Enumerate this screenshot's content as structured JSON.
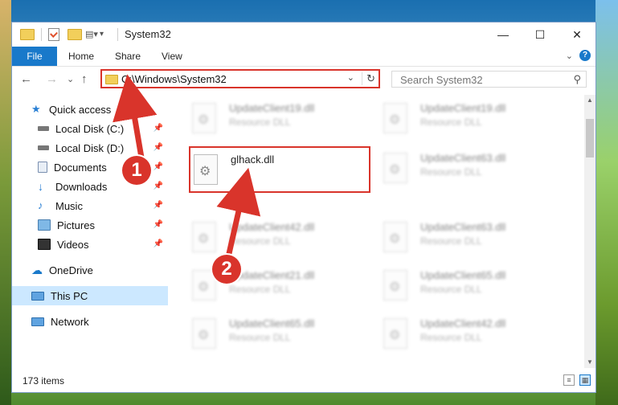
{
  "window": {
    "title": "System32"
  },
  "ribbon": {
    "tabs": [
      "File",
      "Home",
      "Share",
      "View"
    ]
  },
  "titlebar": {
    "minimize": "—",
    "maximize": "☐",
    "close": "✕"
  },
  "nav": {
    "back": "←",
    "forward": "→",
    "recent": "⌄",
    "up": "↑",
    "address": "C:\\Windows\\System32",
    "search_placeholder": "Search System32"
  },
  "sidebar": {
    "items": [
      {
        "label": "Quick access",
        "icon": "star-icon"
      },
      {
        "label": "Local Disk (C:)",
        "icon": "drive-icon"
      },
      {
        "label": "Local Disk (D:)",
        "icon": "drive-icon"
      },
      {
        "label": "Documents",
        "icon": "documents-icon"
      },
      {
        "label": "Downloads",
        "icon": "download-icon"
      },
      {
        "label": "Music",
        "icon": "music-icon"
      },
      {
        "label": "Pictures",
        "icon": "pictures-icon"
      },
      {
        "label": "Videos",
        "icon": "videos-icon"
      },
      {
        "label": "OneDrive",
        "icon": "cloud-icon"
      },
      {
        "label": "This PC",
        "icon": "computer-icon"
      },
      {
        "label": "Network",
        "icon": "network-icon"
      }
    ]
  },
  "files": {
    "col1": [
      {
        "name": "UpdateClient19.dll",
        "type": "Resource DLL"
      },
      {
        "name": "glhack.dll",
        "type": ""
      },
      {
        "name": "UpdateClient42.dll",
        "type": "Resource DLL"
      },
      {
        "name": "UpdateClient21.dll",
        "type": "Resource DLL"
      },
      {
        "name": "UpdateClient65.dll",
        "type": "Resource DLL"
      }
    ],
    "col2": [
      {
        "name": "UpdateClient19.dll",
        "type": "Resource DLL"
      },
      {
        "name": "UpdateClient63.dll",
        "type": "Resource DLL"
      },
      {
        "name": "UpdateClient63.dll",
        "type": "Resource DLL"
      },
      {
        "name": "UpdateClient65.dll",
        "type": "Resource DLL"
      },
      {
        "name": "UpdateClient42.dll",
        "type": "Resource DLL"
      }
    ]
  },
  "status": {
    "items": "173 items"
  },
  "callouts": [
    "1",
    "2"
  ],
  "colors": {
    "accent": "#1979ca",
    "highlight": "#d9342b",
    "selected": "#cce8ff"
  }
}
